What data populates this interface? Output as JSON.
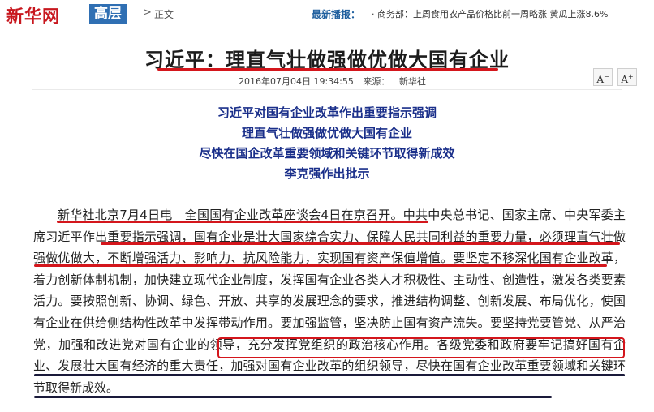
{
  "header": {
    "logo": "新华网",
    "channel": "高层",
    "separator": ">",
    "breadcrumb": "正文",
    "ticker_label": "最新播报：",
    "ticker_text": "· 商务部：上周食用农产品价格比前一周略涨 黄瓜上涨8.6%"
  },
  "article": {
    "title": "习近平：理直气壮做强做优做大国有企业",
    "date": "2016年07月04日 19:34:55",
    "source_label": "来源：",
    "source": "新华社",
    "font_decrease": "A",
    "font_increase": "A",
    "subtitles": [
      "习近平对国有企业改革作出重要指示强调",
      "理直气壮做强做优做大国有企业",
      "尽快在国企改革重要领域和关键环节取得新成效",
      "李克强作出批示"
    ],
    "body": "新华社北京7月4日电　全国国有企业改革座谈会4日在京召开。中共中央总书记、国家主席、中央军委主席习近平作出重要指示强调，国有企业是壮大国家综合实力、保障人民共同利益的重要力量，必须理直气壮做强做优做大，不断增强活力、影响力、抗风险能力，实现国有资产保值增值。要坚定不移深化国有企业改革，着力创新体制机制，加快建立现代企业制度，发挥国有企业各类人才积极性、主动性、创造性，激发各类要素活力。要按照创新、协调、绿色、开放、共享的发展理念的要求，推进结构调整、创新发展、布局优化，使国有企业在供给侧结构性改革中发挥带动作用。要加强监管，坚决防止国有资产流失。要坚持党要管党、从严治党，加强和改进党对国有企业的领导，充分发挥党组织的政治核心作用。各级党委和政府要牢记搞好国有企业、发展壮大国有经济的重大责任，加强对国有企业改革的组织领导，尽快在国有企业改革重要领域和关键环节取得新成效。"
  },
  "colors": {
    "brand_red": "#c8171e",
    "channel_blue": "#2f6fb3",
    "subtitle_navy": "#1a2f8a",
    "annotation_red": "#d4161c",
    "annotation_dark": "#1a1a3a"
  }
}
